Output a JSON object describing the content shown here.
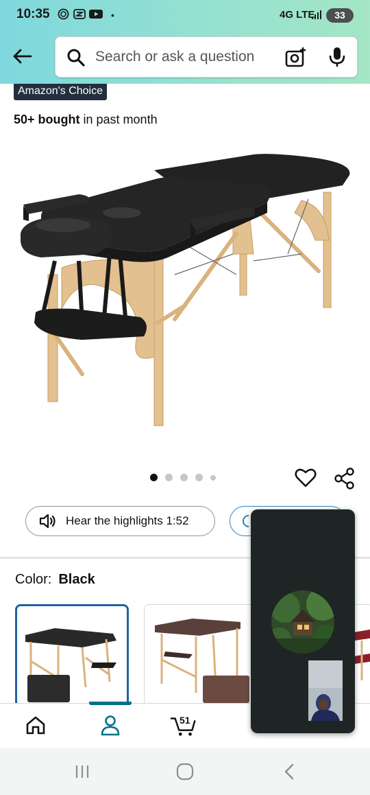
{
  "status_bar": {
    "time": "10:35",
    "network": "4G LTE",
    "battery": "33",
    "dot": "•"
  },
  "search": {
    "placeholder": "Search or ask a question"
  },
  "icons": {
    "back": "arrow-left-icon",
    "search": "search-icon",
    "camera": "camera-lens-icon",
    "mic": "microphone-icon",
    "heart": "heart-icon",
    "share": "share-icon",
    "speaker": "speaker-icon",
    "home": "home-icon",
    "account": "person-icon",
    "cart": "cart-icon"
  },
  "product": {
    "badge": "Amazon's Choice",
    "bought_bold": "50+ bought",
    "bought_rest": " in past month",
    "image_count": 5,
    "active_image": 1,
    "highlights_label": "Hear the highlights 1:52",
    "color_label": "Color:",
    "color_value": "Black"
  },
  "tabbar": {
    "cart_count": "51",
    "active_tab": "account"
  },
  "colors": {
    "accent": "#007185",
    "selected_border": "#2162a1",
    "badge_bg": "#232f3e",
    "header_start": "#7fd8dd",
    "header_end": "#a4e6c5"
  }
}
